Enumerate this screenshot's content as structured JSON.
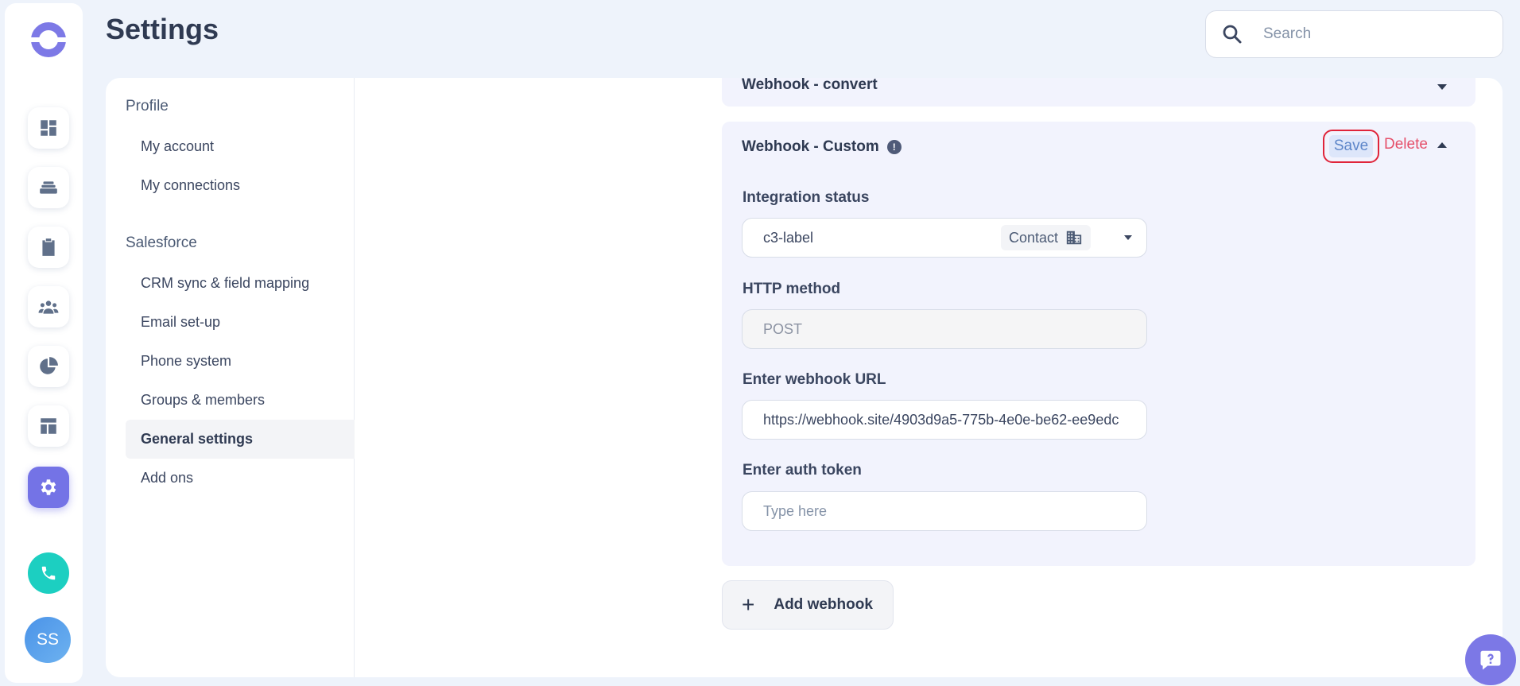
{
  "header": {
    "title": "Settings",
    "search_placeholder": "Search"
  },
  "rail": {
    "items": [
      "dashboard-icon",
      "layers-icon",
      "clipboard-icon",
      "team-icon",
      "pie-chart-icon",
      "layout-icon",
      "gear-icon"
    ],
    "active": "gear-icon",
    "avatar_initials": "SS",
    "accent_color": "#7473e6",
    "phone_color": "#1ccfc1"
  },
  "sub_nav": {
    "profile_heading": "Profile",
    "profile_items": [
      "My account",
      "My connections"
    ],
    "salesforce_heading": "Salesforce",
    "salesforce_items": [
      "CRM sync & field mapping",
      "Email set-up",
      "Phone system",
      "Groups & members",
      "General settings",
      "Add ons"
    ],
    "active_item": "General settings"
  },
  "webhooks": {
    "collapsed_title": "Webhook - convert",
    "expanded": {
      "title": "Webhook - Custom",
      "info_icon": "!",
      "save_label": "Save",
      "delete_label": "Delete",
      "integration_status_label": "Integration status",
      "integration_status_value": "c3-label",
      "integration_status_chip": "Contact",
      "http_method_label": "HTTP method",
      "http_method_value": "POST",
      "url_label": "Enter webhook URL",
      "url_value": "https://webhook.site/4903d9a5-775b-4e0e-be62-ee9edc",
      "auth_label": "Enter auth token",
      "auth_placeholder": "Type here"
    },
    "add_label": "Add webhook"
  }
}
